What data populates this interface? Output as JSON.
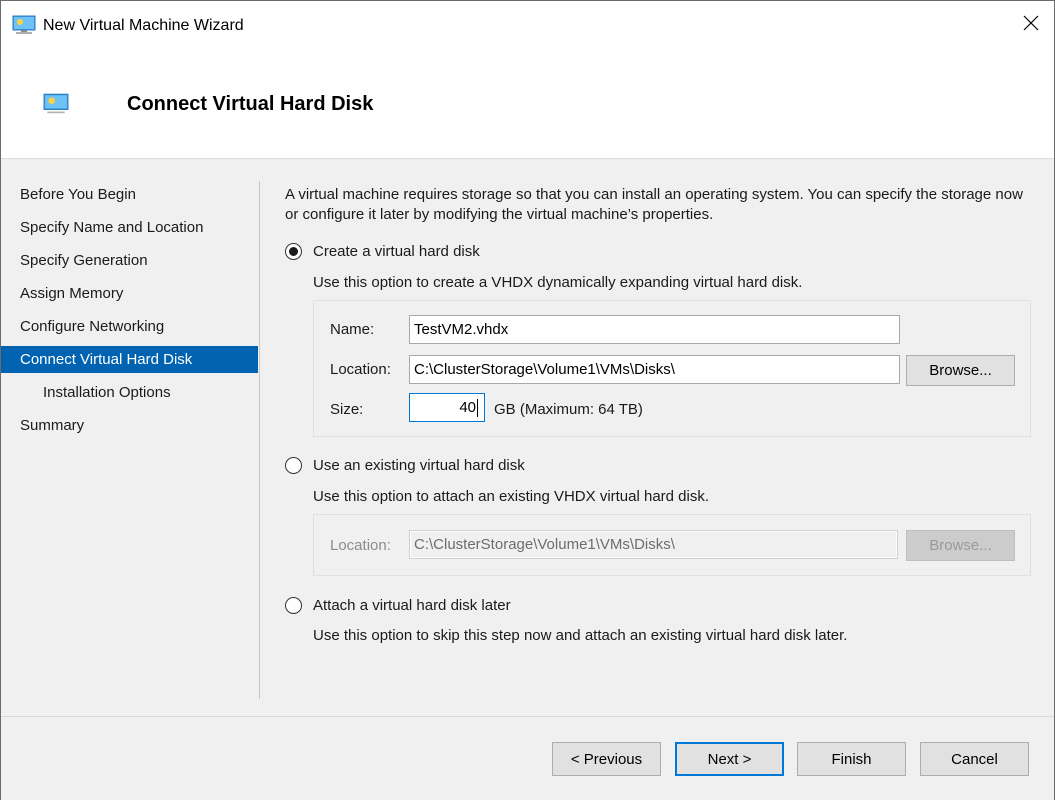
{
  "window": {
    "title": "New Virtual Machine Wizard",
    "icon": "virtual-machine-icon",
    "close_icon": "close-icon"
  },
  "header": {
    "title": "Connect Virtual Hard Disk",
    "icon": "virtual-machine-icon"
  },
  "sidebar": {
    "steps": [
      {
        "label": "Before You Begin",
        "active": false,
        "indent": false
      },
      {
        "label": "Specify Name and Location",
        "active": false,
        "indent": false
      },
      {
        "label": "Specify Generation",
        "active": false,
        "indent": false
      },
      {
        "label": "Assign Memory",
        "active": false,
        "indent": false
      },
      {
        "label": "Configure Networking",
        "active": false,
        "indent": false
      },
      {
        "label": "Connect Virtual Hard Disk",
        "active": true,
        "indent": false
      },
      {
        "label": "Installation Options",
        "active": false,
        "indent": true
      },
      {
        "label": "Summary",
        "active": false,
        "indent": false
      }
    ]
  },
  "main": {
    "intro": "A virtual machine requires storage so that you can install an operating system. You can specify the storage now or configure it later by modifying the virtual machine’s properties.",
    "options": [
      {
        "label": "Create a virtual hard disk",
        "selected": true,
        "description": "Use this option to create a VHDX dynamically expanding virtual hard disk.",
        "fields": {
          "name_label": "Name:",
          "name_value": "TestVM2.vhdx",
          "location_label": "Location:",
          "location_value": "C:\\ClusterStorage\\Volume1\\VMs\\Disks\\",
          "browse_label": "Browse...",
          "size_label": "Size:",
          "size_value": "40",
          "size_unit": "GB (Maximum: 64 TB)"
        }
      },
      {
        "label": "Use an existing virtual hard disk",
        "selected": false,
        "description": "Use this option to attach an existing VHDX virtual hard disk.",
        "fields": {
          "location_label": "Location:",
          "location_value": "C:\\ClusterStorage\\Volume1\\VMs\\Disks\\",
          "browse_label": "Browse..."
        }
      },
      {
        "label": "Attach a virtual hard disk later",
        "selected": false,
        "description": "Use this option to skip this step now and attach an existing virtual hard disk later."
      }
    ]
  },
  "footer": {
    "previous_label": "< Previous",
    "next_label": "Next >",
    "finish_label": "Finish",
    "cancel_label": "Cancel"
  },
  "colors": {
    "accent": "#0063b1",
    "focus_border": "#0078d7"
  }
}
